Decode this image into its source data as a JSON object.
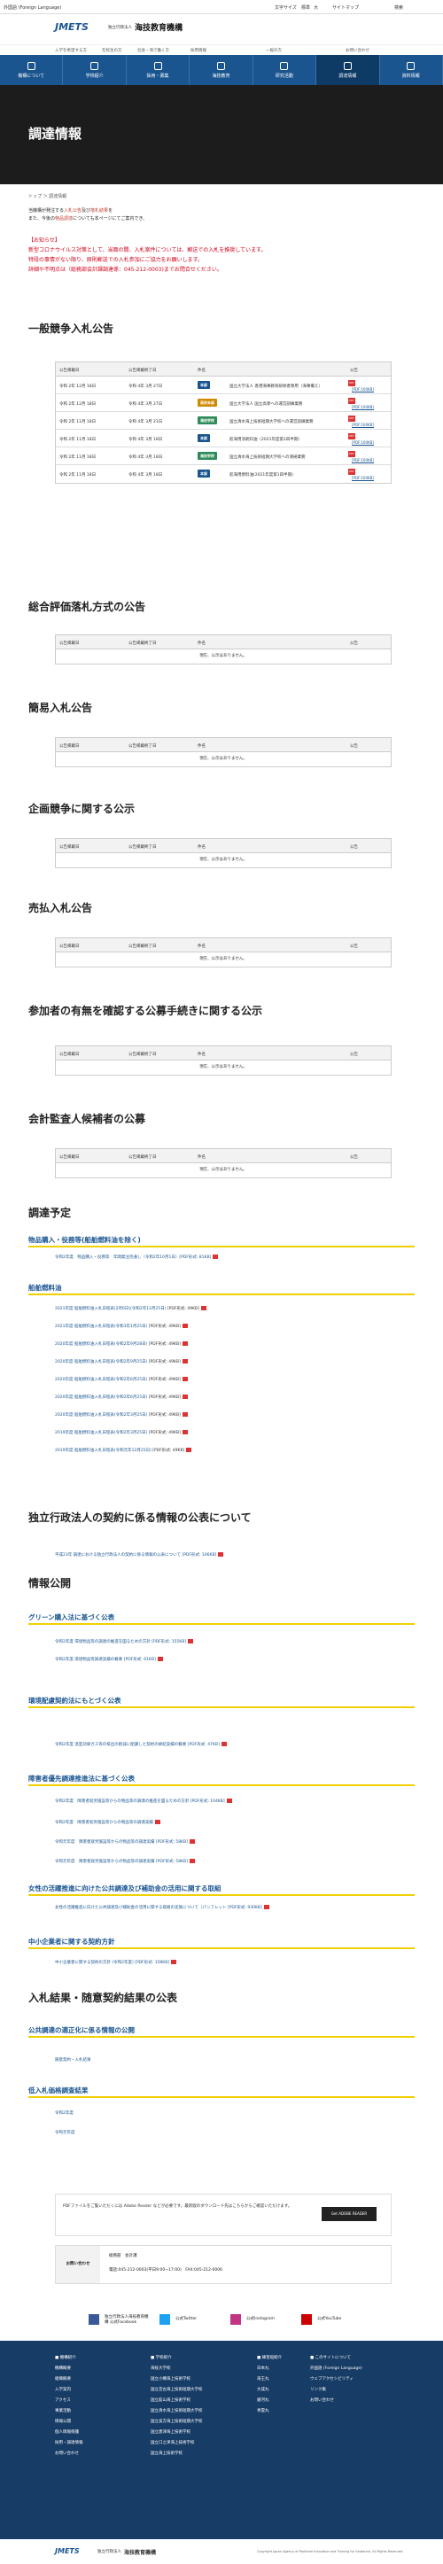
{
  "topbar": {
    "lang": "外国語 (Foreign Language)",
    "fontsize": "文字サイズ",
    "std": "標準",
    "large": "大",
    "sitemap": "サイトマップ",
    "search": "検索"
  },
  "logo": {
    "mark": "JMETS",
    "corp": "独立行政法人",
    "name": "海技教育機構"
  },
  "util": [
    "入学を希望する方",
    "在校生の方",
    "社会・海で働く方",
    "採用情報",
    "一般の方",
    "お問い合わせ"
  ],
  "gnav": [
    "機構について",
    "学校紹介",
    "採用・募集",
    "海技教育",
    "研究活動",
    "調達情報",
    "資料情報"
  ],
  "page_title": "調達情報",
  "breadcrumb": "トップ ＞ 調達情報",
  "intro": {
    "l1a": "当機構が発注する",
    "l1b": "入札公告",
    "l1c": "及び",
    "l1d": "落札結果",
    "l1e": "を",
    "l2a": "また、今後の",
    "l2b": "物品調達",
    "l2c": "についても本ページにてご案内でき、"
  },
  "notice": [
    "【お知らせ】",
    "新型コロナウイルス対策として、当面の間、入札案件については、郵送での入札を推奨しています。",
    "特段の事情がない限り、原則郵送での入札参加にご協力をお願いします。",
    "詳細や不明点は（総務部会計課調達係：045-212-0003)までお問合せください。"
  ],
  "sections": {
    "s1": "一般競争入札公告",
    "s2": "総合評価落札方式の公告",
    "s3": "簡易入札公告",
    "s4": "企画競争に関する公示",
    "s5": "売払入札公告",
    "s6": "参加者の有無を確認する公募手続きに関する公示",
    "s7": "会計監査人候補者の公募",
    "s8": "調達予定",
    "s9": "独立行政法人の契約に係る情報の公表について",
    "s10": "情報公開",
    "s11": "入札結果・随意契約結果の公表"
  },
  "table_headers": {
    "a": "公告掲載日",
    "b": "公告掲載終了日",
    "c": "件名",
    "d": "公告"
  },
  "empty": "現在、公示はありません。",
  "bids": [
    {
      "date": "令和 2年 12月 18日",
      "end": "令和 4年 3月 27日",
      "badge": "本部",
      "title": "国立大学法人 香港海事教育研修者専用（海事備え）"
    },
    {
      "date": "令和 2年 12月 18日",
      "end": "令和 4年 3月 27日",
      "badge": "高校本部",
      "title": "国立大学法人 国立高専への運営訓練業務"
    },
    {
      "date": "令和 2年 11月 18日",
      "end": "令和 4年 3月 21日",
      "badge": "海技学校",
      "title": "国立清水海上技術短期大学校への運営訓練業務"
    },
    {
      "date": "令和 2年 11月 18日",
      "end": "令和 4年 3月 18日",
      "badge": "本部",
      "title": "航海用消耗料油（2021年度第1四半期）"
    },
    {
      "date": "令和 2年 11月 18日",
      "end": "令和 4年 3月 18日",
      "badge": "海技学校",
      "title": "国立清水海上技術短期大学校への清掃業務"
    },
    {
      "date": "令和 2年 11月 18日",
      "end": "令和 4年 3月 18日",
      "badge": "本部",
      "title": "航海用燃料油(2021年度第1四半期)"
    }
  ],
  "pdf_label": "[PDF:100KB]",
  "plan": {
    "h1": "物品購入・役務等(船舶燃料油を除く)",
    "l1": "令和2年度　物品購入・役務等　年間発注見通し（令和2年10月1日）[PDF形式: 81KB]",
    "h2": "船舶燃料油",
    "fuel": [
      "2021年度 船舶燃料油入札日程表(2月6日)(令和2年12月25日)",
      "2021年度 船舶燃料油入札日程表(令和3年1月25日)",
      "2020年度 船舶燃料油入札日程表(令和2年9月28日)",
      "2020年度 船舶燃料油入札日程表(令和2年9月25日)",
      "2020年度 船舶燃料油入札日程表(令和2年6月25日)",
      "2020年度 船舶燃料油入札日程表(令和2年6月25日)",
      "2020年度 船舶燃料油入札日程表(令和2年3月25日)",
      "2019年度 船舶燃料油入札日程表(令和2年3月25日)",
      "2019年度 船舶燃料油入札日程表(令和元年12月25日)"
    ],
    "fuel_size": "[PDF形式: 49KB]"
  },
  "contract_pub": "平成23年 調達における独立行政法人の契約に係る情報の公表について [PDF形式: 106KB]",
  "green": {
    "h": "グリーン購入法に基づく公表",
    "items": [
      "令和2年度 環境物品等の調達の推進を図るための方針 [PDF形式: 155KB]",
      "令和2年度 環境物品等調達実績の概要 [PDF形式: 61KB]"
    ]
  },
  "env": {
    "h": "環境配慮契約法にもとづく公表",
    "items": [
      "令和2年度 温室効果ガス等の排出の削減に配慮した契約の締結実績の概要 [PDF形式: 47KB]"
    ]
  },
  "disab": {
    "h": "障害者優先調達推進法に基づく公表",
    "items": [
      "令和2年度　障害者就労施設等からの物品等の調達の推進を図るための方針 [PDF形式: 104KB]",
      "令和2年度　障害者就労施設等からの物品等の調達実績",
      "令和元年度　障害者就労施設等からの物品等の調達実績 [PDF形式: 58KB]",
      "令和元年度　障害者就労施設等からの物品等の調達実績 [PDF形式: 58KB]"
    ]
  },
  "women": {
    "h": "女性の活躍推進に向けた公共調達及び補助金の活用に関する取組",
    "items": [
      "女性の活躍推進に向けた公共調達及び補助金の活用に関する取組の実施について（パンフレット [PDF形式: 930KB]"
    ]
  },
  "sme": {
    "h": "中小企業者に関する契約方針",
    "items": [
      "中小企業者に関する契約の方針 (令和2年度) [PDF形式: 158KB]"
    ]
  },
  "fair": {
    "h": "公共調達の適正化に係る情報の公開",
    "items": [
      "随意契約・入札結果"
    ]
  },
  "low": {
    "h": "低入札価格調査結果",
    "items": [
      "令和2年度",
      "令和元年度"
    ]
  },
  "reader": "PDFファイルをご覧いただくには Adobe Reader などが必要です。最新版のダウンロード先はこちらからご確認いただけます。",
  "reader_btn": "Get ADOBE READER",
  "contact": {
    "title": "お問い合わせ",
    "org": "総務部　会計課",
    "tel": "電話:045-212-0003(平日9:00~17:00)　FAX:045-212-0006"
  },
  "social": [
    "独立行政法人海技教育機構 公式Facebook",
    "公式Twitter",
    "公式Instagram",
    "公式YouTube"
  ],
  "footer": {
    "c1": [
      "■ 機構紹介",
      "機構概要",
      "組織概要",
      "入学案内",
      "アクセス",
      "事業活動",
      "情報公開",
      "個人情報保護",
      "採用・調達情報",
      "お問い合わせ"
    ],
    "c2": [
      "■ 学校紹介",
      "海技大学校",
      "国立小樽海上技術学校",
      "国立宮古海上技術短期大学校",
      "国立館山海上技術学校",
      "国立清水海上技術短期大学校",
      "国立波方海上技術短期大学校",
      "国立唐津海上技術学校",
      "国立口之津海上技術学校",
      "国立海上技術学校"
    ],
    "c3": [
      "■ 練習船紹介",
      "日本丸",
      "海王丸",
      "大成丸",
      "銀河丸",
      "青雲丸"
    ],
    "c4": [
      "■ このサイトについて",
      "外国語 (Foreign Language)",
      "ウェブアクセシビリティ",
      "リンク集",
      "お問い合わせ"
    ]
  },
  "copyright": "Copyright Japan Agency of Maritime Education and Training for Seafarers. All Rights Reserved."
}
